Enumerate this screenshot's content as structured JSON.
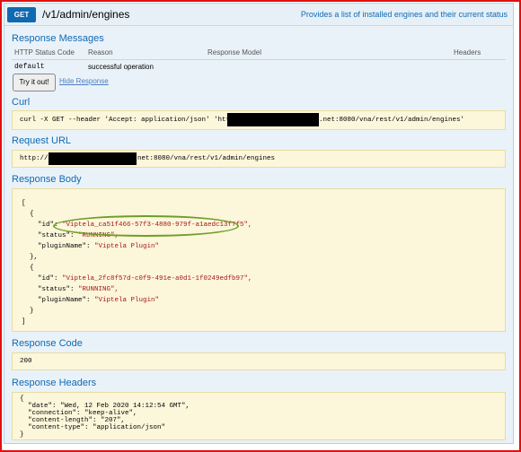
{
  "header": {
    "method": "GET",
    "path": "/v1/admin/engines",
    "summary": "Provides a list of installed engines and their current status"
  },
  "response_messages": {
    "title": "Response Messages",
    "columns": [
      "HTTP Status Code",
      "Reason",
      "Response Model",
      "Headers"
    ],
    "rows": [
      {
        "code": "default",
        "reason": "successful operation"
      }
    ]
  },
  "buttons": {
    "try_it": "Try it out!",
    "hide_response": "Hide Response"
  },
  "curl": {
    "title": "Curl",
    "prefix": "curl -X GET --header 'Accept: application/json' 'http:/",
    "suffix": ".net:8080/vna/rest/v1/admin/engines'"
  },
  "request_url": {
    "title": "Request URL",
    "prefix": "http://",
    "suffix": "net:8080/vna/rest/v1/admin/engines"
  },
  "response_body": {
    "title": "Response Body",
    "open_bracket": "[",
    "close_bracket": "]",
    "open_brace": "{",
    "close_brace": "},",
    "close_brace_last": "}",
    "items": [
      {
        "id_key": "\"id\": ",
        "id": "\"Viptela_ca51f466-57f3-4880-979f-a1aedc13f7f5\",",
        "status_key": "\"status\": ",
        "status": "\"RUNNING\",",
        "plugin_key": "\"pluginName\": ",
        "plugin": "\"Viptela Plugin\""
      },
      {
        "id_key": "\"id\": ",
        "id": "\"Viptela_2fc8f57d-c0f9-491e-a0d1-1f0249edfb97\",",
        "status_key": "\"status\": ",
        "status": "\"RUNNING\",",
        "plugin_key": "\"pluginName\": ",
        "plugin": "\"Viptela Plugin\""
      }
    ]
  },
  "response_code": {
    "title": "Response Code",
    "value": "200"
  },
  "response_headers": {
    "title": "Response Headers",
    "lines": [
      "{",
      "  \"date\": \"Wed, 12 Feb 2020 14:12:54 GMT\",",
      "  \"connection\": \"keep-alive\",",
      "  \"content-length\": \"207\",",
      "  \"content-type\": \"application/json\"",
      "}"
    ]
  },
  "colors": {
    "accent": "#0f6ab4",
    "frame": "#e01010",
    "highlight": "#6e9e2a"
  }
}
